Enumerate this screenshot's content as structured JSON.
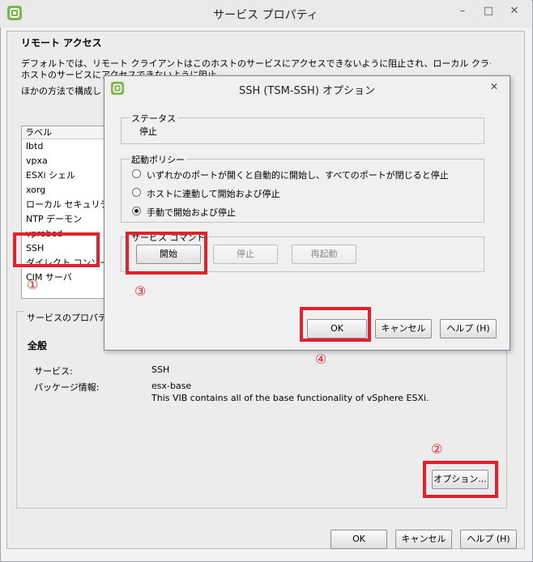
{
  "window": {
    "title": "サービス プロパティ",
    "minimize": "–",
    "maximize": "□",
    "close": "✕"
  },
  "remote_access": {
    "title": "リモート アクセス",
    "desc_line1": "デフォルトでは、リモート クライアントはこのホストのサービスにアクセスできないように阻止され、ローカル クライアントはリモート",
    "desc_line2": "ホストのサービスにアクセスできないように阻止",
    "desc_line3": "ほかの方法で構成し"
  },
  "service_list": {
    "header": "ラベル",
    "items": [
      "lbtd",
      "vpxa",
      "ESXi シェル",
      "xorg",
      "ローカル セキュリティ",
      "NTP デーモン",
      "vprobed",
      "SSH",
      "ダイレクト コンソール",
      "CIM サーバ"
    ]
  },
  "properties": {
    "legend": "サービスのプロパティ",
    "general": "全般",
    "service_label": "サービス:",
    "service_value": "SSH",
    "package_label": "パッケージ情報:",
    "package_value": "esx-base",
    "package_desc": "This VIB contains all of the base functionality of vSphere ESXi.",
    "options_button": "オプション..."
  },
  "outer_buttons": {
    "ok": "OK",
    "cancel": "キャンセル",
    "help": "ヘルプ (H)"
  },
  "dialog": {
    "title": "SSH (TSM-SSH) オプション",
    "close": "✕",
    "status_legend": "ステータス",
    "status_value": "停止",
    "policy_legend": "起動ポリシー",
    "policies": [
      {
        "label": "いずれかのポートが開くと自動的に開始し、すべてのポートが閉じると停止",
        "selected": false
      },
      {
        "label": "ホストに連動して開始および停止",
        "selected": false
      },
      {
        "label": "手動で開始および停止",
        "selected": true
      }
    ],
    "command_legend": "サービス コマンド",
    "start": "開始",
    "stop": "停止",
    "restart": "再起動",
    "ok": "OK",
    "cancel": "キャンセル",
    "help": "ヘルプ (H)"
  },
  "annotations": {
    "step1": "①",
    "step2": "②",
    "step3": "③",
    "step4": "④",
    "color": "#e5202b"
  },
  "icons": {
    "app": "vsphere-icon"
  }
}
